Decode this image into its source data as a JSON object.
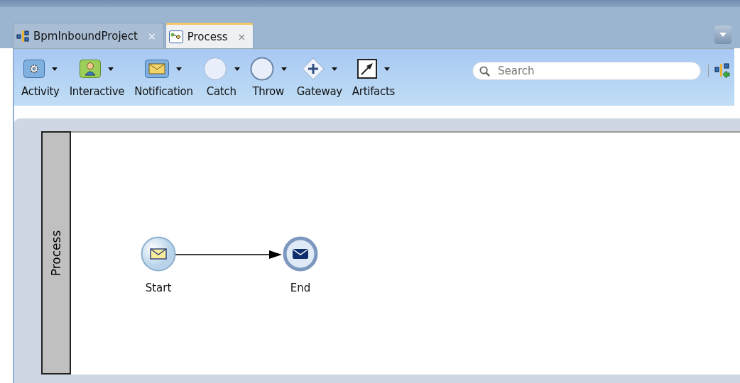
{
  "tabs": [
    {
      "label": "BpmInboundProject",
      "close": "×",
      "selected": false
    },
    {
      "label": "Process",
      "close": "×",
      "selected": true
    }
  ],
  "toolbar": {
    "items": [
      {
        "kind": "activity",
        "label": "Activity"
      },
      {
        "kind": "interactive",
        "label": "Interactive"
      },
      {
        "kind": "notification",
        "label": "Notification"
      },
      {
        "kind": "catch",
        "label": "Catch"
      },
      {
        "kind": "throw",
        "label": "Throw"
      },
      {
        "kind": "gateway",
        "label": "Gateway"
      },
      {
        "kind": "artifacts",
        "label": "Artifacts"
      }
    ],
    "search": {
      "placeholder": "Search"
    }
  },
  "lane": {
    "label": "Process"
  },
  "diagram": {
    "nodes": [
      {
        "kind": "start",
        "label": "Start"
      },
      {
        "kind": "end",
        "label": "End"
      }
    ]
  }
}
